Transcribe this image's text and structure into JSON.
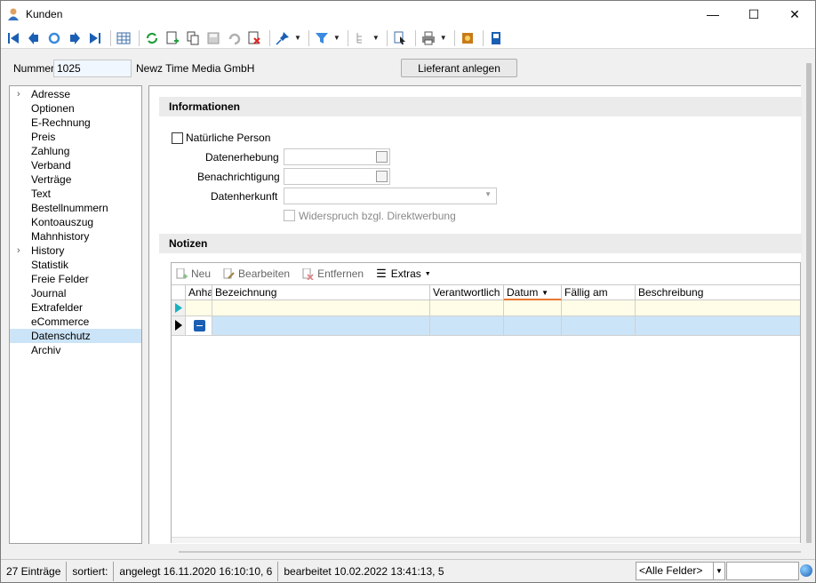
{
  "window": {
    "title": "Kunden",
    "minimize": "—",
    "maximize": "☐",
    "close": "✕"
  },
  "header": {
    "number_label": "Nummer",
    "number_value": "1025",
    "company": "Newz Time Media GmbH",
    "create_supplier_button": "Lieferant anlegen"
  },
  "sidebar": {
    "items": [
      {
        "label": "Adresse",
        "expandable": true
      },
      {
        "label": "Optionen"
      },
      {
        "label": "E-Rechnung"
      },
      {
        "label": "Preis"
      },
      {
        "label": "Zahlung"
      },
      {
        "label": "Verband"
      },
      {
        "label": "Verträge"
      },
      {
        "label": "Text"
      },
      {
        "label": "Bestellnummern"
      },
      {
        "label": "Kontoauszug"
      },
      {
        "label": "Mahnhistory"
      },
      {
        "label": "History",
        "expandable": true
      },
      {
        "label": "Statistik"
      },
      {
        "label": "Freie Felder"
      },
      {
        "label": "Journal"
      },
      {
        "label": "Extrafelder"
      },
      {
        "label": "eCommerce"
      },
      {
        "label": "Datenschutz",
        "selected": true
      },
      {
        "label": "Archiv"
      }
    ]
  },
  "informationen": {
    "title": "Informationen",
    "natural_person": "Natürliche Person",
    "data_collection": "Datenerhebung",
    "notification": "Benachrichtigung",
    "data_origin": "Datenherkunft",
    "objection": "Widerspruch bzgl. Direktwerbung"
  },
  "notizen": {
    "title": "Notizen",
    "toolbar": {
      "new": "Neu",
      "edit": "Bearbeiten",
      "remove": "Entfernen",
      "extras": "Extras"
    },
    "columns": [
      "Anha",
      "Bezeichnung",
      "Verantwortlich",
      "Datum",
      "Fällig am",
      "Beschreibung"
    ],
    "sort_column": "Datum"
  },
  "status": {
    "entries": "27 Einträge",
    "sorted": "sortiert:",
    "created": "angelegt 16.11.2020 16:10:10,  6",
    "edited": "bearbeitet 10.02.2022 13:41:13,  5",
    "fields_filter": "<Alle Felder>"
  },
  "colors": {
    "selection": "#cce4f7",
    "accent": "#1a5fb4",
    "new_row": "#fffde7"
  }
}
